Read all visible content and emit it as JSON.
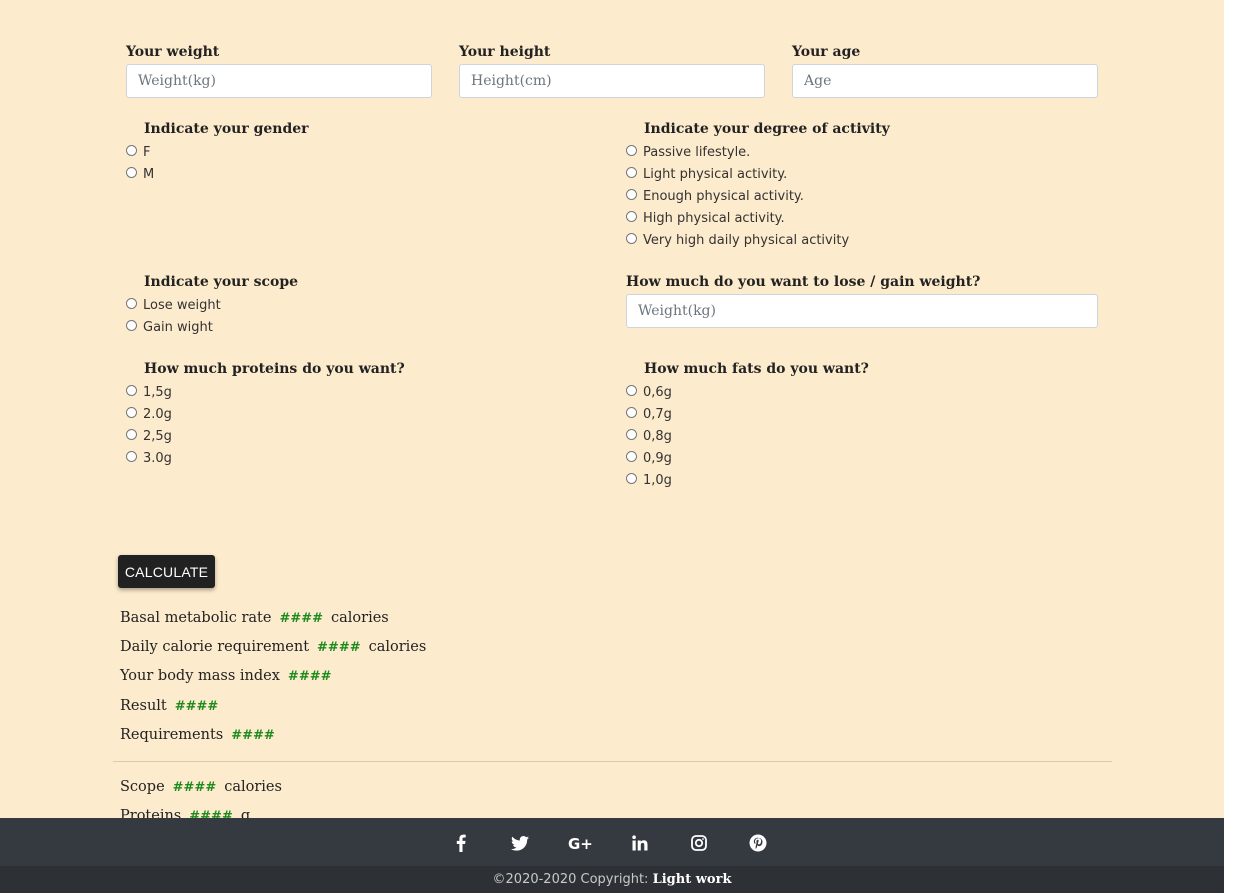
{
  "form": {
    "weight": {
      "label": "Your weight",
      "placeholder": "Weight(kg)"
    },
    "height": {
      "label": "Your height",
      "placeholder": "Height(cm)"
    },
    "age": {
      "label": "Your age",
      "placeholder": "Age"
    },
    "gender": {
      "title": "Indicate your gender",
      "options": [
        "F",
        "M"
      ]
    },
    "activity": {
      "title": "Indicate your degree of activity",
      "options": [
        "Passive lifestyle.",
        "Light physical activity.",
        "Enough physical activity.",
        "High physical activity.",
        "Very high daily physical activity"
      ]
    },
    "scope": {
      "title": "Indicate your scope",
      "options": [
        "Lose weight",
        "Gain wight"
      ]
    },
    "weight_change": {
      "label": "How much do you want to lose / gain weight?",
      "placeholder": "Weight(kg)"
    },
    "proteins": {
      "title": "How much proteins do you want?",
      "options": [
        "1,5g",
        "2.0g",
        "2,5g",
        "3.0g"
      ]
    },
    "fats": {
      "title": "How much fats do you want?",
      "options": [
        "0,6g",
        "0,7g",
        "0,8g",
        "0,9g",
        "1,0g"
      ]
    },
    "calculate_label": "CALCULATE"
  },
  "results": {
    "bmr": {
      "label": "Basal metabolic rate",
      "value": "####",
      "unit": "calories"
    },
    "daily": {
      "label": "Daily calorie requirement",
      "value": "####",
      "unit": "calories"
    },
    "bmi": {
      "label": "Your body mass index",
      "value": "####"
    },
    "result": {
      "label": "Result",
      "value": "####"
    },
    "requirements": {
      "label": "Requirements",
      "value": "####"
    },
    "scope": {
      "label": "Scope",
      "value": "####",
      "unit": "calories"
    },
    "proteins": {
      "label": "Proteins",
      "value": "####",
      "unit": "g"
    }
  },
  "footer": {
    "social_icons": [
      "facebook-icon",
      "twitter-icon",
      "google-plus-icon",
      "linkedin-icon",
      "instagram-icon",
      "pinterest-icon"
    ],
    "copyright_text": "©2020-2020 Copyright:",
    "copyright_brand": "Light work"
  },
  "colors": {
    "page_bg": "#fdebcd",
    "result_value": "#1d8a1d",
    "footer_bg": "#343a40",
    "button_bg": "#212121"
  }
}
